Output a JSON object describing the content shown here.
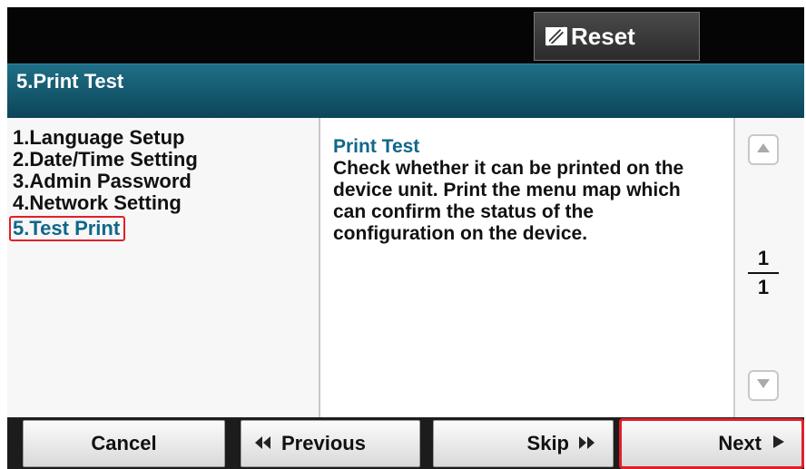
{
  "header": {
    "reset_label": "Reset",
    "reset_icon": "pencil-slash-icon"
  },
  "title": "5.Print Test",
  "menu": {
    "items": [
      {
        "label": "1.Language Setup",
        "active": false
      },
      {
        "label": "2.Date/Time Setting",
        "active": false
      },
      {
        "label": "3.Admin Password",
        "active": false
      },
      {
        "label": "4.Network Setting",
        "active": false
      },
      {
        "label": "5.Test Print",
        "active": true
      }
    ]
  },
  "description": {
    "title": "Print Test",
    "body": "Check whether it can be printed on the device unit. Print the menu map which can confirm the status of the configuration on the device."
  },
  "pager": {
    "current": "1",
    "total": "1",
    "up_icon": "triangle-up-icon",
    "down_icon": "triangle-down-icon"
  },
  "footer": {
    "cancel_label": "Cancel",
    "previous_label": "Previous",
    "previous_icon": "double-chevron-left-icon",
    "skip_label": "Skip",
    "skip_icon": "double-chevron-right-icon",
    "next_label": "Next",
    "next_icon": "triangle-right-icon"
  },
  "colors": {
    "title_bar": "#0c4559",
    "accent_text": "#10678a",
    "highlight_border": "#e0202a"
  }
}
